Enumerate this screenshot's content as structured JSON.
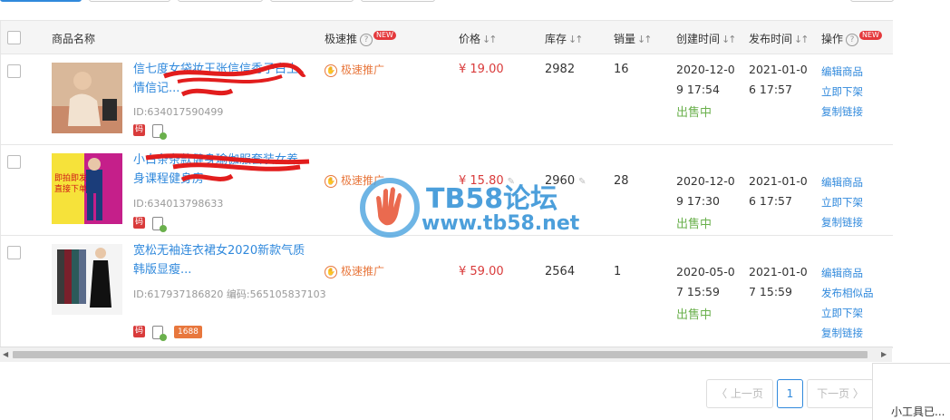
{
  "table": {
    "headers": {
      "name": "商品名称",
      "promo": "极速推",
      "price": "价格",
      "stock": "库存",
      "sales": "销量",
      "created": "创建时间",
      "published": "发布时间",
      "ops": "操作",
      "new_badge": "NEW"
    },
    "rows": [
      {
        "title": "信七度女袋妆王张信信秀子白土情信记...",
        "id": "ID:634017590499",
        "promo": "极速推广",
        "price": "¥ 19.00",
        "stock": "2982",
        "sales": "16",
        "created": "2020-12-09 17:54",
        "published": "2021-01-06 17:57",
        "status": "出售中",
        "ops": [
          "编辑商品",
          "立即下架",
          "复制链接"
        ]
      },
      {
        "title": "小白条条款健身瑜伽服套装女养身课程健身房",
        "id": "ID:634013798633",
        "promo": "极速推广",
        "price": "¥ 15.80",
        "stock": "2960",
        "sales": "28",
        "created": "2020-12-09 17:30",
        "published": "2021-01-06 17:57",
        "status": "出售中",
        "ops": [
          "编辑商品",
          "立即下架",
          "复制链接"
        ]
      },
      {
        "title": "宽松无袖连衣裙女2020新款气质韩版显瘦...",
        "id": "ID:617937186820 编码:565105837103",
        "promo": "极速推广",
        "price": "¥ 59.00",
        "stock": "2564",
        "sales": "1",
        "created": "2020-05-07 15:59",
        "published": "2021-01-07 15:59",
        "status": "出售中",
        "ops": [
          "编辑商品",
          "发布相似品",
          "立即下架",
          "复制链接"
        ]
      }
    ],
    "tag_ma": "码",
    "tag_1688": "1688"
  },
  "thumb_labels": {
    "row2_top": "即拍即发",
    "row2_bottom": "直接下单"
  },
  "pagination": {
    "prev": "〈 上一页",
    "current": "1",
    "next": "下一页 〉"
  },
  "watermark": {
    "title": "TB58论坛",
    "url": "www.tb58.net"
  },
  "side_panel": {
    "text": "小工具已..."
  },
  "colors": {
    "link": "#3089dc",
    "price": "#d93b3b",
    "status": "#6ab04c",
    "promo": "#e8773d"
  }
}
